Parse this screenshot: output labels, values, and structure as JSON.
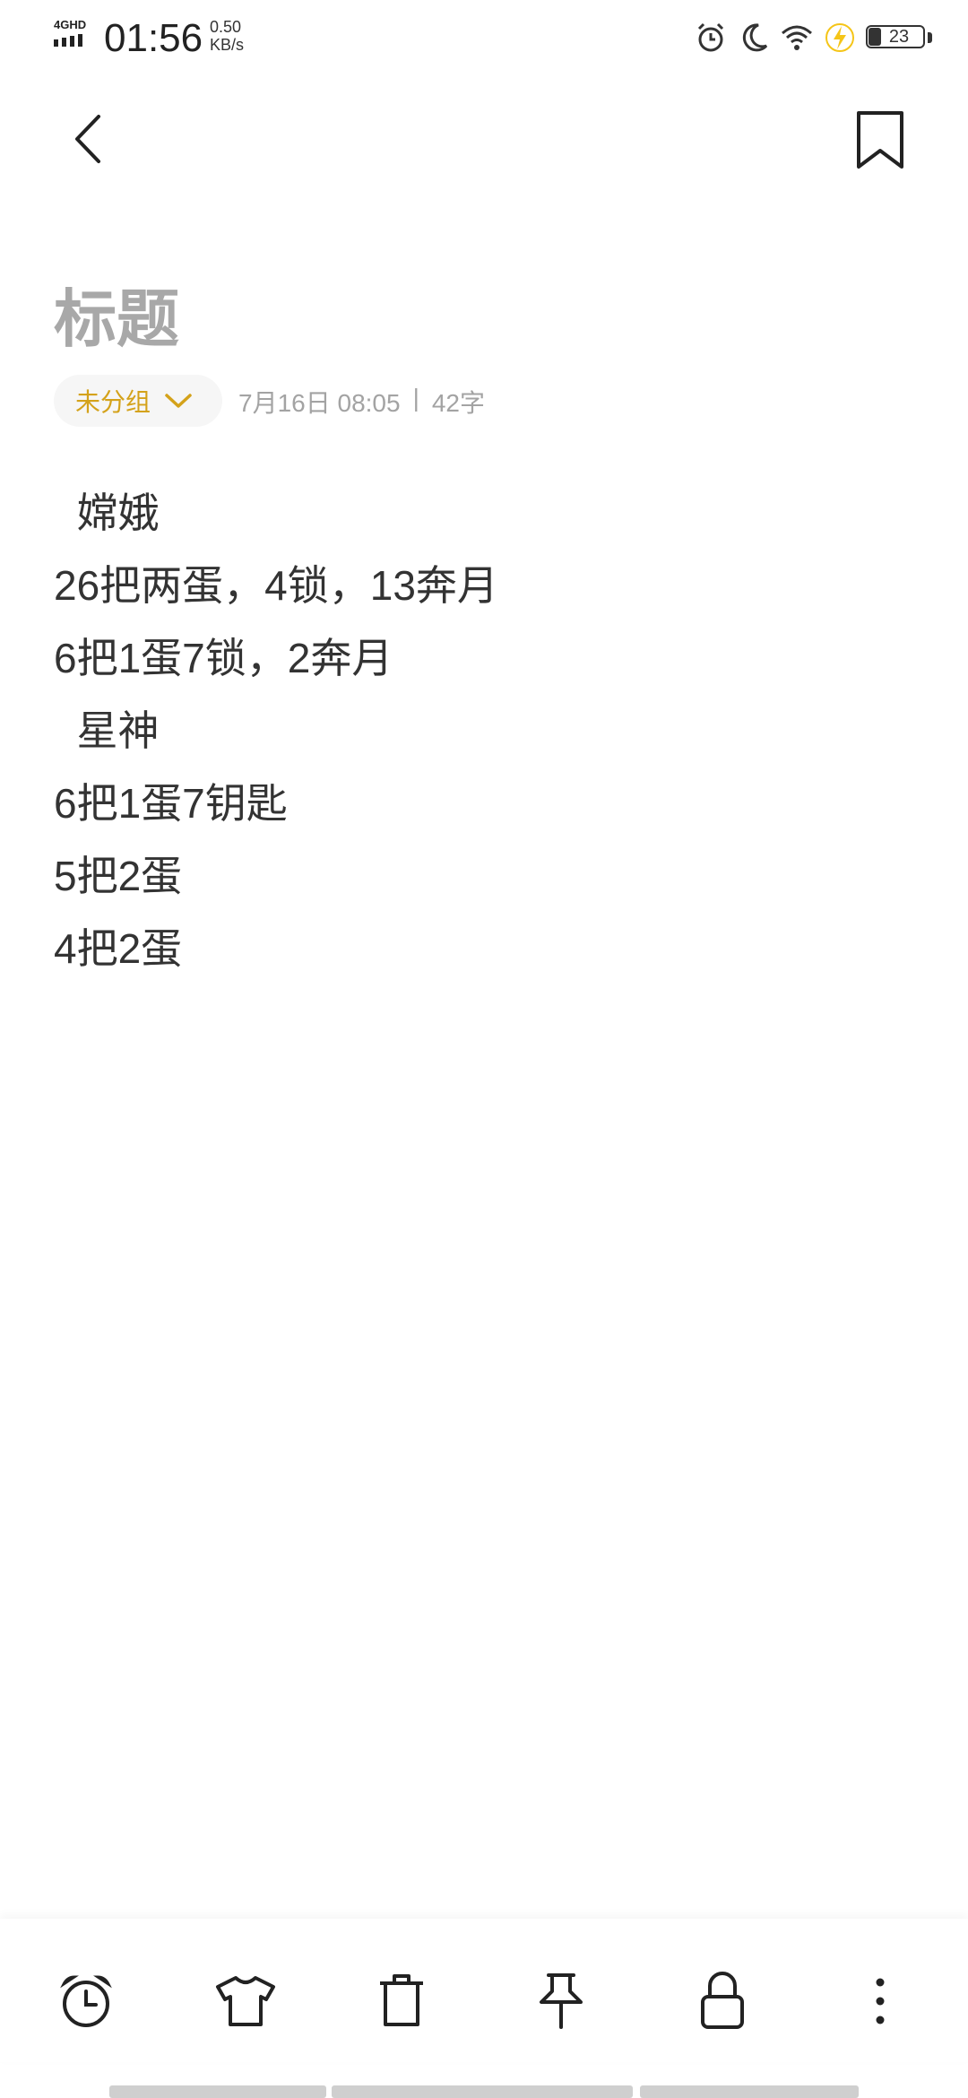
{
  "status_bar": {
    "network": "4GHD",
    "time": "01:56",
    "speed_value": "0.50",
    "speed_unit": "KB/s",
    "battery_level": "23",
    "icons": [
      "alarm-icon",
      "moon-icon",
      "wifi-icon",
      "charging-icon",
      "battery-icon"
    ]
  },
  "colors": {
    "accent": "#d4a21a",
    "title_placeholder": "#a8a8a8",
    "meta_text": "#a3a3a3",
    "body_text": "#333333"
  },
  "note": {
    "title_placeholder": "标题",
    "group_label": "未分组",
    "date": "7月16日 08:05",
    "separator": "|",
    "char_count": "42字",
    "lines": [
      "  嫦娥",
      "26把两蛋，4锁，13奔月",
      "6把1蛋7锁，2奔月",
      "  星神",
      "6把1蛋7钥匙",
      "5把2蛋",
      "4把2蛋"
    ]
  },
  "toolbar": {
    "items": [
      "alarm-clock-icon",
      "shirt-icon",
      "trash-icon",
      "pin-icon",
      "lock-icon",
      "more-vertical-icon"
    ]
  }
}
